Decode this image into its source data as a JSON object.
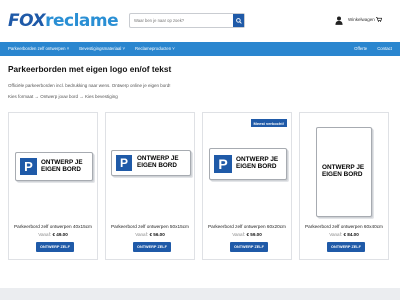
{
  "header": {
    "logo_part1": "FOX",
    "logo_part2": "reclame",
    "search_placeholder": "Waar ben je naar op zoek?",
    "cart_label": "Winkelwagen"
  },
  "nav": {
    "items": [
      "Parkeerborden zelf ontwerpen ˅",
      "Bevestigingsmateriaal ˅",
      "Reclameproducten ˅"
    ],
    "right": [
      "Offerte",
      "Contact"
    ]
  },
  "page": {
    "title": "Parkeerborden met eigen logo en/of tekst",
    "description": "Officiële parkeerborden incl. bedrukking naar wens. Ontwerp online je eigen bord!",
    "steps": "Kies formaat → Ontwerp jouw bord → Kies bevestiging"
  },
  "products": [
    {
      "name": "Parkeerbord zelf ontwerpen 40x15cm",
      "vanaf": "Vanaf:",
      "price": "€ 49.00",
      "button": "ONTWERP ZELF",
      "plate_text": "ONTWERP JE EIGEN BORD",
      "badge": ""
    },
    {
      "name": "Parkeerbord zelf ontwerpen 50x15cm",
      "vanaf": "Vanaf:",
      "price": "€ 56.00",
      "button": "ONTWERP ZELF",
      "plate_text": "ONTWERP JE EIGEN BORD",
      "badge": ""
    },
    {
      "name": "Parkeerbord zelf ontwerpen 60x20cm",
      "vanaf": "Vanaf:",
      "price": "€ 59.00",
      "button": "ONTWERP ZELF",
      "plate_text": "ONTWERP JE EIGEN BORD",
      "badge": "Meest verkocht!"
    },
    {
      "name": "Parkeerbord zelf ontwerpen 60x40cm",
      "vanaf": "Vanaf:",
      "price": "€ 84.00",
      "button": "ONTWERP ZELF",
      "plate_text": "ONTWERP JE EIGEN BORD",
      "badge": ""
    }
  ],
  "icons": {
    "search": "search-icon",
    "user": "user-icon",
    "cart": "cart-icon",
    "parking": "parking-p-icon"
  },
  "colors": {
    "brand_dark": "#1f5aa8",
    "brand_light": "#2a86cf",
    "accent_text": "#2a8fd4"
  }
}
